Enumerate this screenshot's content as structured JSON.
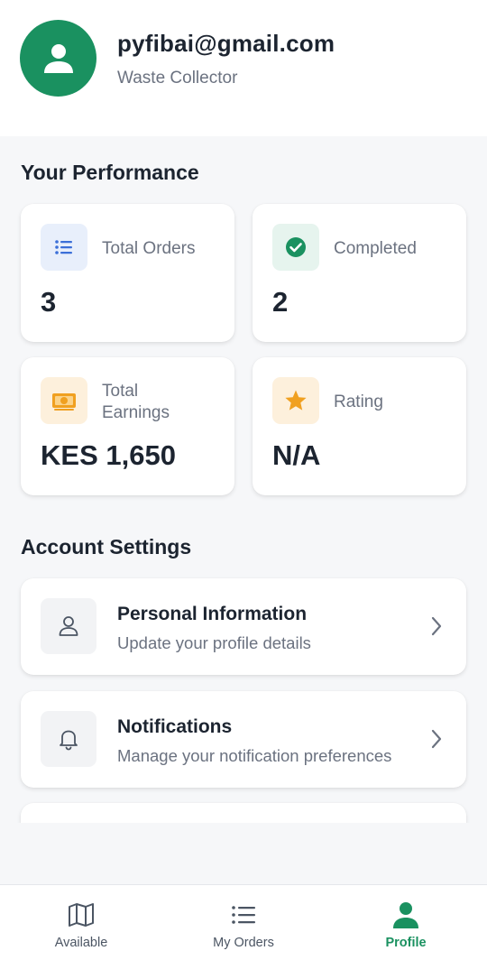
{
  "profile": {
    "email": "pyfibai@gmail.com",
    "role": "Waste Collector"
  },
  "performance": {
    "title": "Your Performance",
    "stats": [
      {
        "label": "Total Orders",
        "value": "3",
        "icon": "list-icon",
        "icon_bg": "#e8effb",
        "icon_color": "#3b6fd8"
      },
      {
        "label": "Completed",
        "value": "2",
        "icon": "check-circle-icon",
        "icon_bg": "#e6f4ee",
        "icon_color": "#1a9160"
      },
      {
        "label": "Total Earnings",
        "value": "KES 1,650",
        "icon": "money-icon",
        "icon_bg": "#fdf0dc",
        "icon_color": "#f0a020"
      },
      {
        "label": "Rating",
        "value": "N/A",
        "icon": "star-icon",
        "icon_bg": "#fdf0dc",
        "icon_color": "#f0a020"
      }
    ]
  },
  "settings": {
    "title": "Account Settings",
    "items": [
      {
        "title": "Personal Information",
        "subtitle": "Update your profile details",
        "icon": "person-icon"
      },
      {
        "title": "Notifications",
        "subtitle": "Manage your notification preferences",
        "icon": "bell-icon"
      }
    ]
  },
  "nav": {
    "items": [
      {
        "label": "Available",
        "icon": "map-icon",
        "active": false
      },
      {
        "label": "My Orders",
        "icon": "list-icon",
        "active": false
      },
      {
        "label": "Profile",
        "icon": "person-icon",
        "active": true
      }
    ]
  },
  "colors": {
    "brand": "#1a9160",
    "text": "#1c2430",
    "muted": "#6b7280"
  }
}
